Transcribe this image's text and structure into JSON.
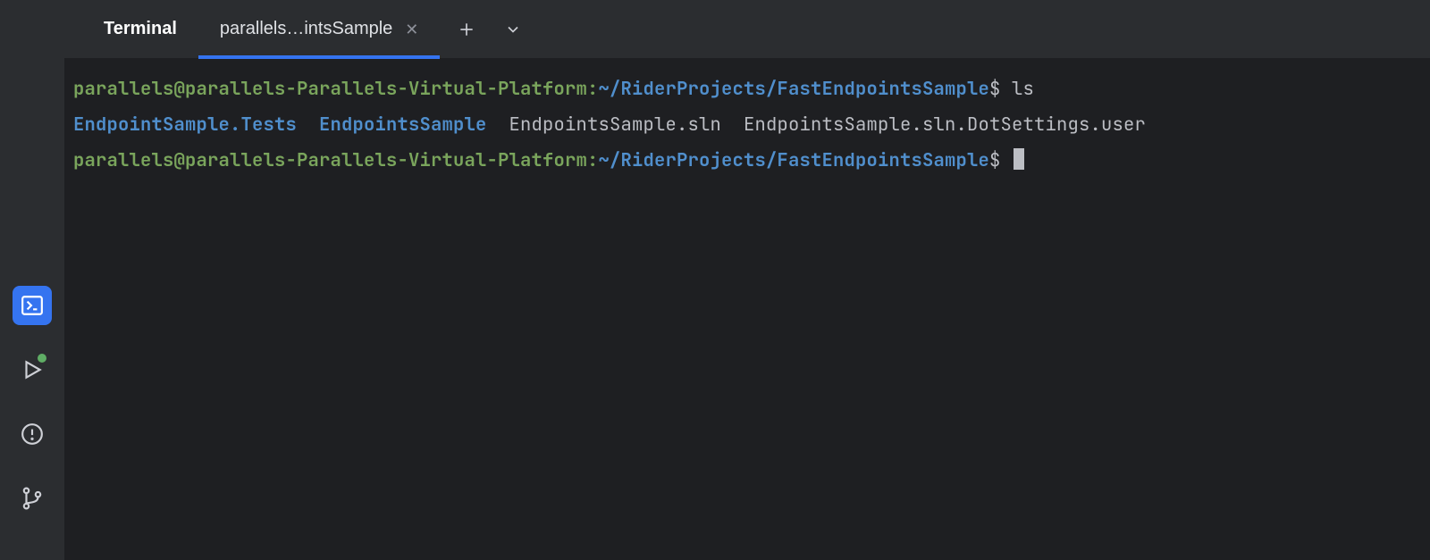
{
  "sidebar": {
    "icons": [
      "terminal-icon",
      "run-icon",
      "problems-icon",
      "vcs-icon"
    ]
  },
  "tabs": {
    "primary": "Terminal",
    "active": "parallels…intsSample"
  },
  "terminal": {
    "prompt_userhost": "parallels@parallels-Parallels-Virtual-Platform",
    "prompt_sep": ":",
    "prompt_path": "~/RiderProjects/FastEndpointsSample",
    "prompt_dollar": "$",
    "cmd1": "ls",
    "ls_dir1": "EndpointSample.Tests",
    "ls_dir2": "EndpointsSample",
    "ls_file1": "EndpointsSample.sln",
    "ls_file2": "EndpointsSample.sln.DotSettings.user"
  }
}
